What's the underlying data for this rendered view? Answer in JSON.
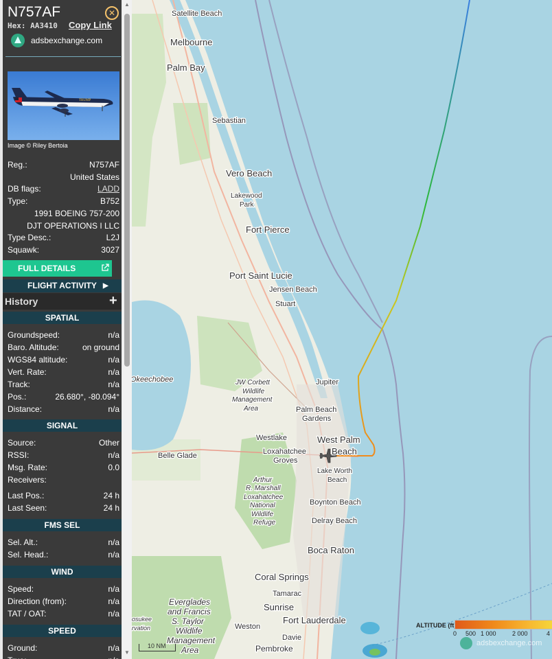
{
  "aircraft": {
    "callsign": "N757AF",
    "hex_label": "Hex: AA3410",
    "copy_link": "Copy Link",
    "source_site": "adsbexchange.com",
    "photo_caption": "Image © Riley Bertoia",
    "photo_livery_text": "TRUMP"
  },
  "details": {
    "reg_key": "Reg.:",
    "reg_val": "N757AF",
    "country": "United States",
    "dbflags_key": "DB flags:",
    "dbflags_val": "LADD",
    "type_key": "Type:",
    "type_val": "B752",
    "model": "1991 BOEING 757-200",
    "owner": "DJT OPERATIONS I LLC",
    "typedesc_key": "Type Desc.:",
    "typedesc_val": "L2J",
    "squawk_key": "Squawk:",
    "squawk_val": "3027"
  },
  "buttons": {
    "full_details": "FULL DETAILS",
    "flight_activity": "FLIGHT ACTIVITY",
    "history": "History",
    "history_toggle": "+"
  },
  "spatial": {
    "header": "SPATIAL",
    "rows": [
      {
        "k": "Groundspeed:",
        "v": "n/a"
      },
      {
        "k": "Baro. Altitude:",
        "v": "on ground"
      },
      {
        "k": "WGS84 altitude:",
        "v": "n/a"
      },
      {
        "k": "Vert. Rate:",
        "v": "n/a"
      },
      {
        "k": "Track:",
        "v": "n/a"
      },
      {
        "k": "Pos.:",
        "v": "26.680°, -80.094°"
      },
      {
        "k": "Distance:",
        "v": "n/a"
      }
    ]
  },
  "signal": {
    "header": "SIGNAL",
    "rows": [
      {
        "k": "Source:",
        "v": "Other"
      },
      {
        "k": "RSSI:",
        "v": "n/a"
      },
      {
        "k": "Msg. Rate:",
        "v": "0.0"
      },
      {
        "k": "Receivers:",
        "v": ""
      },
      {
        "k": "Last Pos.:",
        "v": "24 h"
      },
      {
        "k": "Last Seen:",
        "v": "24 h"
      }
    ]
  },
  "fms": {
    "header": "FMS SEL",
    "rows": [
      {
        "k": "Sel. Alt.:",
        "v": "n/a"
      },
      {
        "k": "Sel. Head.:",
        "v": "n/a"
      }
    ]
  },
  "wind": {
    "header": "WIND",
    "rows": [
      {
        "k": "Speed:",
        "v": "n/a"
      },
      {
        "k": "Direction (from):",
        "v": "n/a"
      },
      {
        "k": "TAT / OAT:",
        "v": "n/a"
      }
    ]
  },
  "speed": {
    "header": "SPEED",
    "rows": [
      {
        "k": "Ground:",
        "v": "n/a"
      },
      {
        "k": "True:",
        "v": "n/a"
      }
    ]
  },
  "map": {
    "places": {
      "satellite_beach": "Satellite Beach",
      "melbourne": "Melbourne",
      "palm_bay": "Palm Bay",
      "sebastian": "Sebastian",
      "vero_beach": "Vero Beach",
      "lakewood_park": "Lakewood Park",
      "fort_pierce": "Fort Pierce",
      "port_saint_lucie": "Port Saint Lucie",
      "jensen_beach": "Jensen Beach",
      "stuart": "Stuart",
      "okeechobee": "Okeechobee",
      "jw_corbett": [
        "JW Corbett",
        "Wildlife",
        "Management",
        "Area"
      ],
      "jupiter": "Jupiter",
      "palm_beach_gardens": [
        "Palm Beach",
        "Gardens"
      ],
      "westlake": "Westlake",
      "west_palm_beach": [
        "West Palm",
        "Beach"
      ],
      "loxahatchee_groves": [
        "Loxahatchee",
        "Groves"
      ],
      "belle_glade": "Belle Glade",
      "lake_worth_beach": [
        "Lake Worth",
        "Beach"
      ],
      "arthur_marshall": [
        "Arthur",
        "R. Marshall",
        "Loxahatchee",
        "National",
        "Wildlife",
        "Refuge"
      ],
      "boynton_beach": "Boynton Beach",
      "delray_beach": "Delray Beach",
      "boca_raton": "Boca Raton",
      "coral_springs": "Coral Springs",
      "tamarac": "Tamarac",
      "sunrise": "Sunrise",
      "fort_lauderdale": "Fort Lauderdale",
      "everglades": [
        "Everglades",
        "and Francis",
        "S. Taylor",
        "Wildlife",
        "Management",
        "Area"
      ],
      "weston": "Weston",
      "davie": "Davie",
      "pembroke": "Pembroke",
      "reservation_fragment": [
        "osukee",
        "rvation"
      ]
    },
    "scale_label": "10 NM",
    "altitude_legend": {
      "title": "ALTITUDE (ft)",
      "ticks": [
        "0",
        "500",
        "1 000",
        "2 000",
        "4"
      ]
    },
    "watermark": "adsbexchange.com",
    "colors": {
      "water": "#a9d4e3",
      "land": "#f2efe9",
      "track_ground": "#f08a1b",
      "track_high": "#3a7ee0"
    }
  }
}
